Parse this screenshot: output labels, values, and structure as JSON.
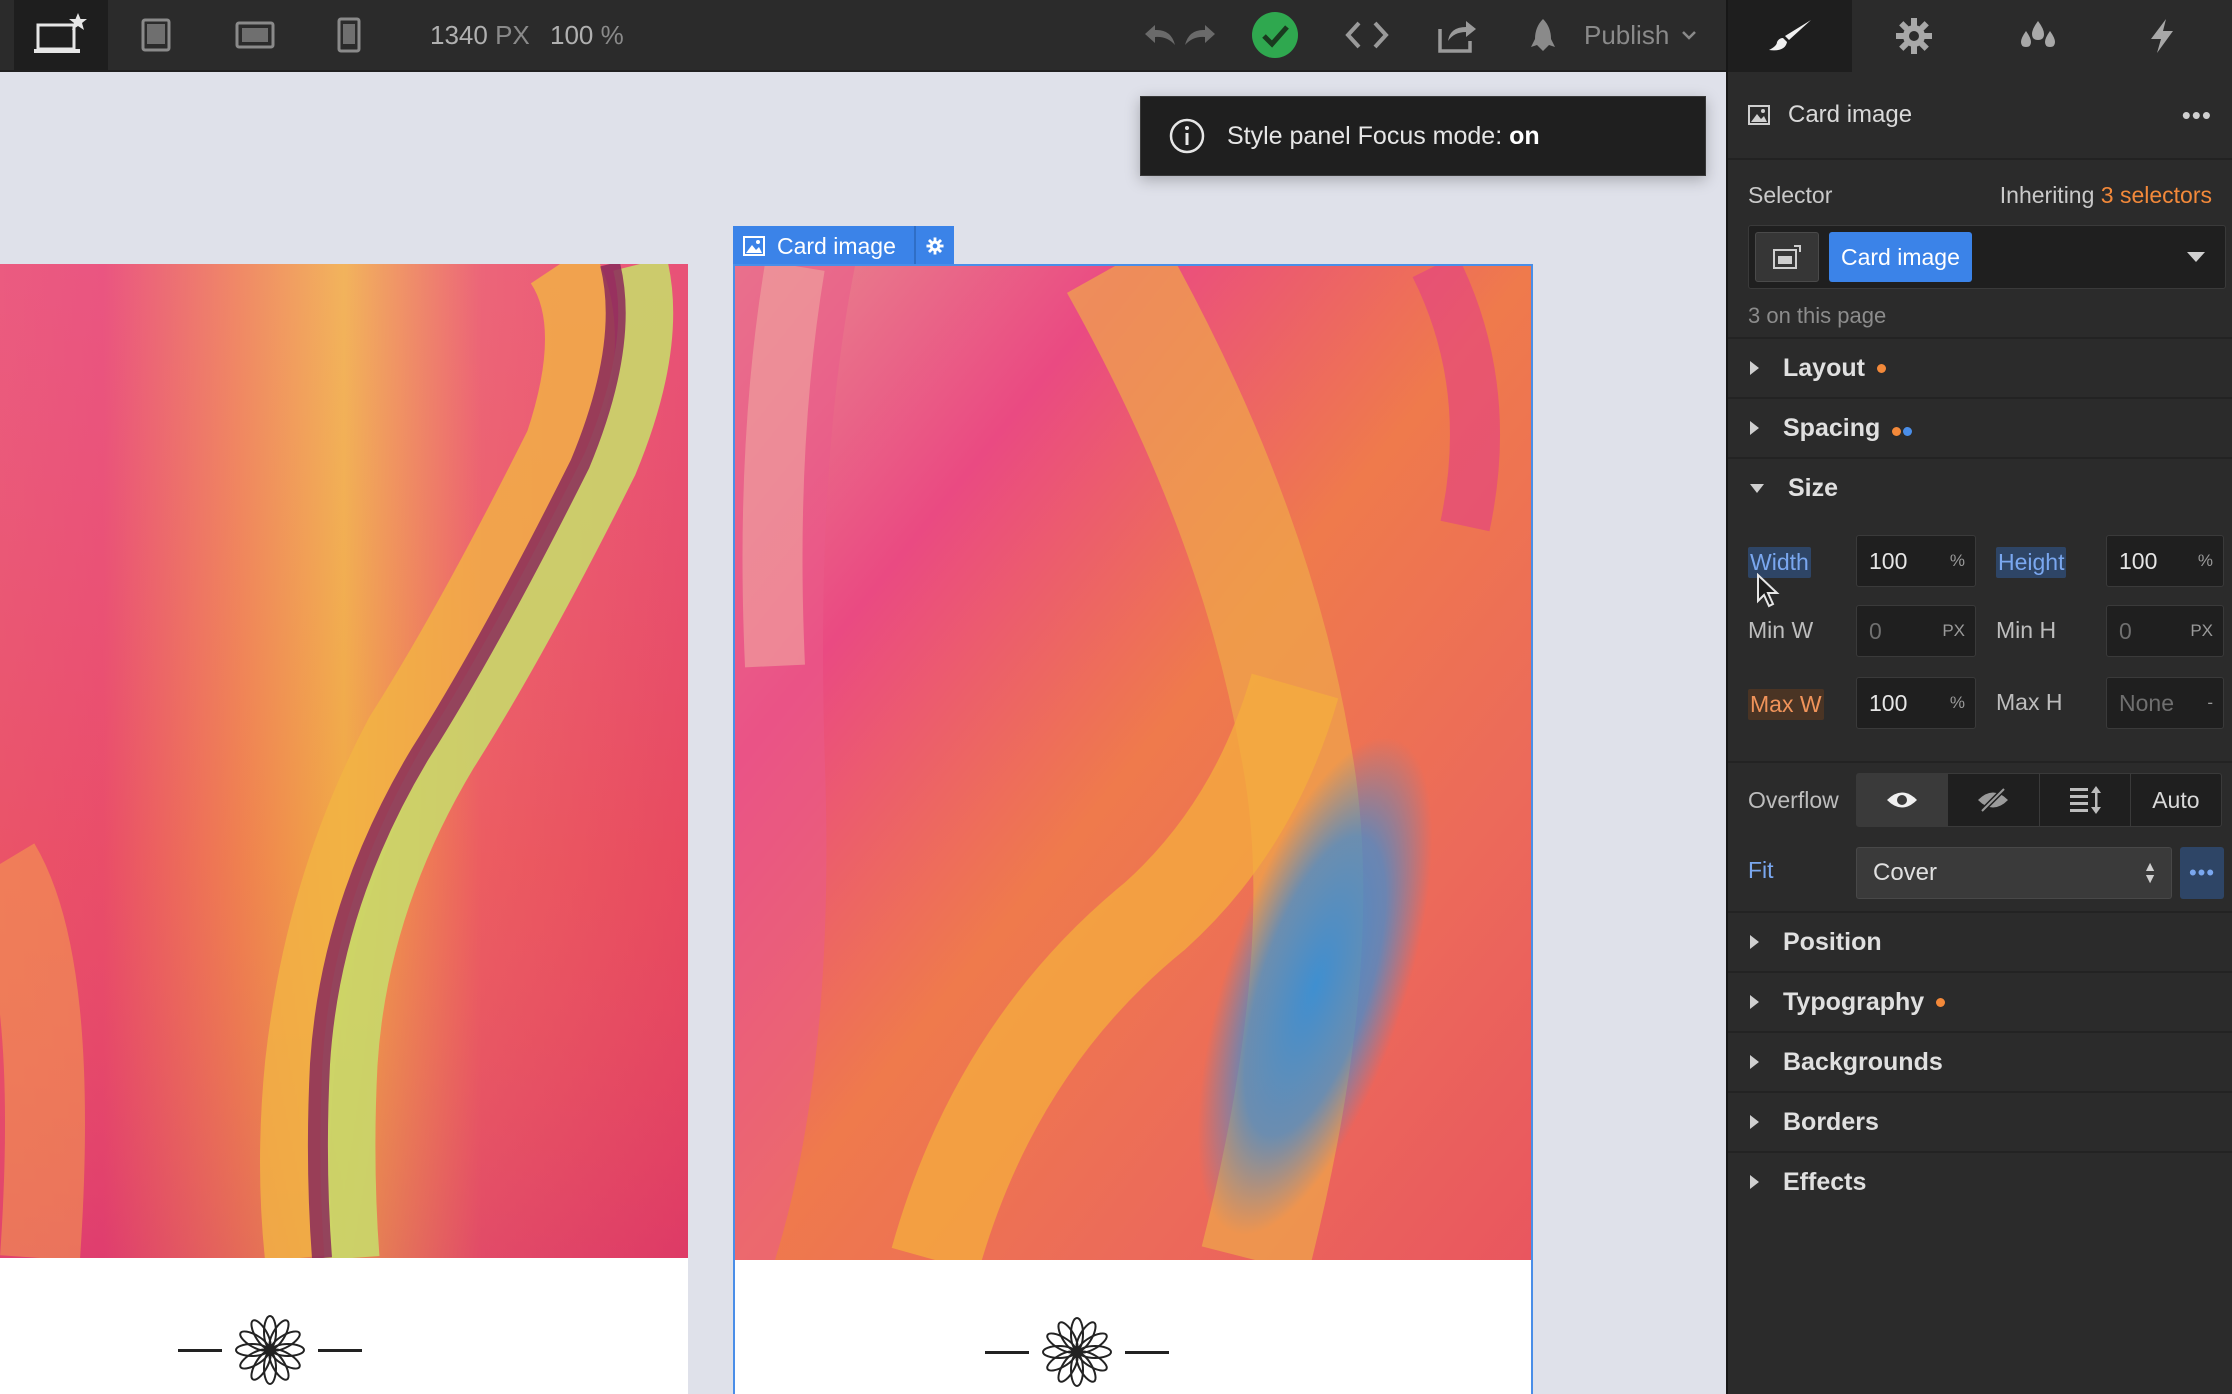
{
  "topbar": {
    "width_value": "1340",
    "width_unit": "PX",
    "zoom_value": "100",
    "zoom_unit": "%",
    "publish_label": "Publish"
  },
  "colors": {
    "accent_blue": "#3b83e8",
    "status_green": "#2fa84f",
    "inherit_orange": "#f3893a"
  },
  "toast": {
    "text": "Style panel Focus mode:",
    "state": "on"
  },
  "canvas": {
    "selected_tag": "Card image"
  },
  "panel": {
    "element_name": "Card image",
    "more_label": "•••",
    "selector_label": "Selector",
    "inheriting_label": "Inheriting",
    "inheriting_count": "3 selectors",
    "selector_chip": "Card image",
    "on_page": "3 on this page",
    "sections": {
      "layout": "Layout",
      "spacing": "Spacing",
      "size": "Size",
      "position": "Position",
      "typography": "Typography",
      "backgrounds": "Backgrounds",
      "borders": "Borders",
      "effects": "Effects"
    },
    "size": {
      "width_label": "Width",
      "width_value": "100",
      "width_unit": "%",
      "height_label": "Height",
      "height_value": "100",
      "height_unit": "%",
      "minw_label": "Min W",
      "minw_value": "0",
      "minw_unit": "PX",
      "minh_label": "Min H",
      "minh_value": "0",
      "minh_unit": "PX",
      "maxw_label": "Max W",
      "maxw_value": "100",
      "maxw_unit": "%",
      "maxh_label": "Max H",
      "maxh_value": "None",
      "maxh_unit": "-",
      "overflow_label": "Overflow",
      "overflow_auto": "Auto",
      "fit_label": "Fit",
      "fit_value": "Cover",
      "fit_more": "•••"
    }
  }
}
